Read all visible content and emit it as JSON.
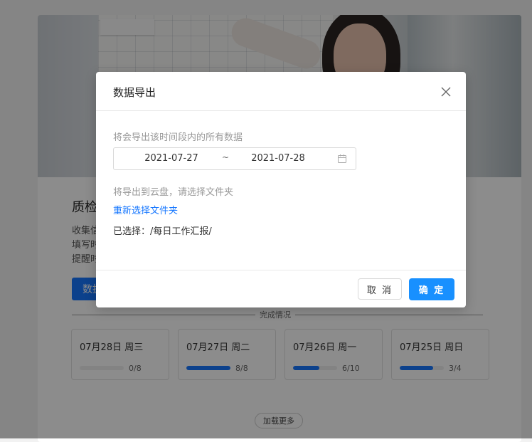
{
  "card": {
    "title": "质检",
    "desc_lines": [
      "收集信",
      "填写时",
      "提醒时"
    ],
    "data_button": "数据"
  },
  "completion": {
    "label": "完成情况",
    "days": [
      {
        "date": "07月28日 周三",
        "done": 0,
        "total": 8,
        "count": "0/8"
      },
      {
        "date": "07月27日 周二",
        "done": 8,
        "total": 8,
        "count": "8/8"
      },
      {
        "date": "07月26日 周一",
        "done": 6,
        "total": 10,
        "count": "6/10"
      },
      {
        "date": "07月25日 周日",
        "done": 3,
        "total": 4,
        "count": "3/4"
      }
    ],
    "load_more": "加载更多"
  },
  "modal": {
    "title": "数据导出",
    "range_hint": "将会导出该时间段内的所有数据",
    "range": {
      "start": "2021-07-27",
      "separator": "~",
      "end": "2021-07-28"
    },
    "cloud_hint": "将导出到云盘，请选择文件夹",
    "reselect_link": "重新选择文件夹",
    "selected_label": "已选择：",
    "selected_path": "/每日工作汇报/",
    "cancel": "取 消",
    "ok": "确 定"
  },
  "colors": {
    "primary": "#1890ff",
    "progress": "#1677ff",
    "mask": "rgba(0,0,0,0.45)"
  }
}
